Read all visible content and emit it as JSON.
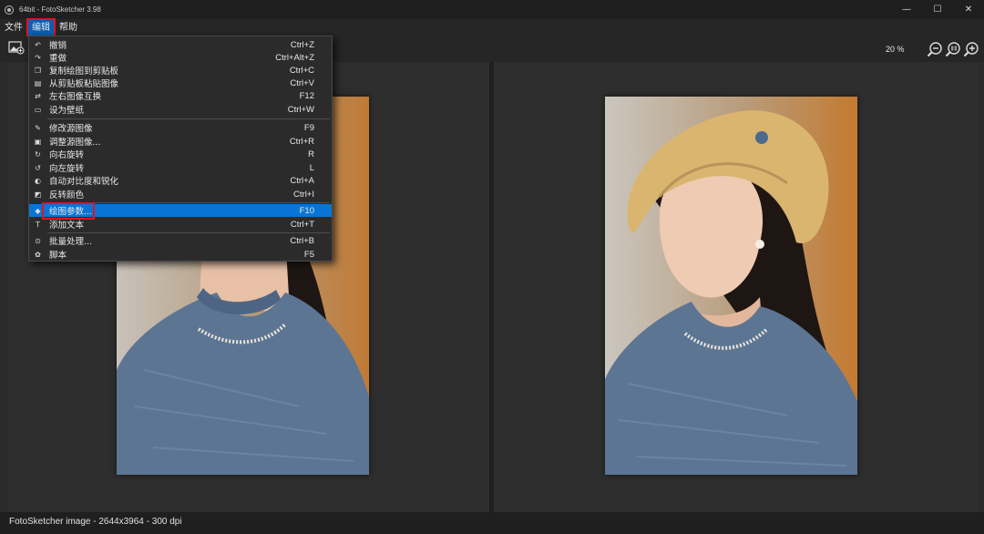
{
  "window": {
    "title": "64bit - FotoSketcher 3.98",
    "minimize": "—",
    "maximize": "☐",
    "close": "✕"
  },
  "menubar": {
    "items": [
      {
        "label": "文件"
      },
      {
        "label": "编辑"
      },
      {
        "label": "帮助"
      }
    ]
  },
  "toolbar": {
    "zoom": "20 %"
  },
  "edit_menu": {
    "group1": [
      {
        "label": "撤销",
        "shortcut": "Ctrl+Z",
        "icon": "undo-icon",
        "glyph": "↶"
      },
      {
        "label": "重做",
        "shortcut": "Ctrl+Alt+Z",
        "icon": "redo-icon",
        "glyph": "↷"
      },
      {
        "label": "复制绘图到剪贴板",
        "shortcut": "Ctrl+C",
        "icon": "copy-icon",
        "glyph": "❐"
      },
      {
        "label": "从剪贴板粘贴图像",
        "shortcut": "Ctrl+V",
        "icon": "paste-icon",
        "glyph": "▤"
      },
      {
        "label": "左右图像互换",
        "shortcut": "F12",
        "icon": "swap-icon",
        "glyph": "⇄"
      },
      {
        "label": "设为壁纸",
        "shortcut": "Ctrl+W",
        "icon": "wallpaper-icon",
        "glyph": "▭"
      }
    ],
    "group2": [
      {
        "label": "修改源图像",
        "shortcut": "F9",
        "icon": "modify-source-icon",
        "glyph": "✎"
      },
      {
        "label": "调整源图像...",
        "shortcut": "Ctrl+R",
        "icon": "adjust-source-icon",
        "glyph": "▣"
      },
      {
        "label": "向右旋转",
        "shortcut": "R",
        "icon": "rotate-right-icon",
        "glyph": "↻"
      },
      {
        "label": "向左旋转",
        "shortcut": "L",
        "icon": "rotate-left-icon",
        "glyph": "↺"
      },
      {
        "label": "自动对比度和锐化",
        "shortcut": "Ctrl+A",
        "icon": "auto-contrast-icon",
        "glyph": "◐"
      },
      {
        "label": "反转颜色",
        "shortcut": "Ctrl+I",
        "icon": "invert-colors-icon",
        "glyph": "◩"
      }
    ],
    "group3": [
      {
        "label": "绘图参数...",
        "shortcut": "F10",
        "icon": "drawing-params-icon",
        "glyph": "◆"
      },
      {
        "label": "添加文本",
        "shortcut": "Ctrl+T",
        "icon": "add-text-icon",
        "glyph": "T"
      }
    ],
    "group4": [
      {
        "label": "批量处理...",
        "shortcut": "Ctrl+B",
        "icon": "batch-icon",
        "glyph": "⊙"
      },
      {
        "label": "脚本",
        "shortcut": "F5",
        "icon": "script-icon",
        "glyph": "✿"
      }
    ]
  },
  "statusbar": {
    "text": "FotoSketcher image - 2644x3964 - 300 dpi"
  },
  "colors": {
    "highlight": "#0a74d4",
    "annotation": "#e0141e"
  }
}
